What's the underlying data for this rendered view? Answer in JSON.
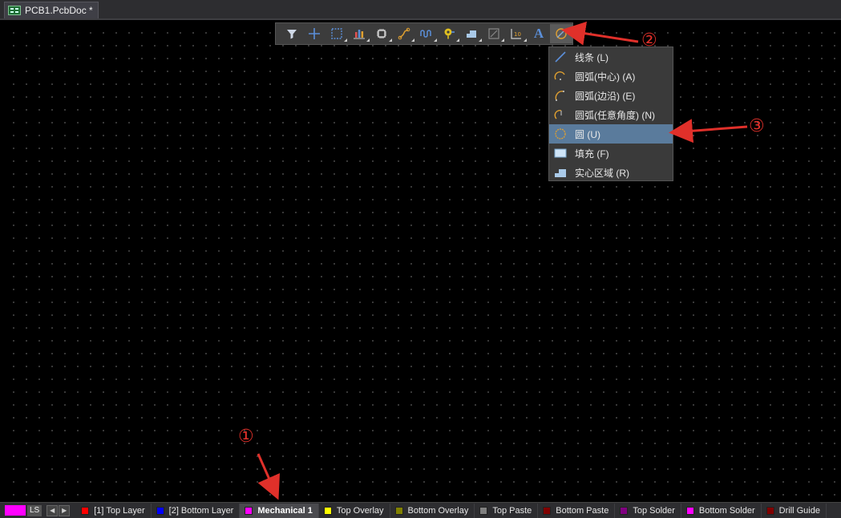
{
  "tab": {
    "title": "PCB1.PcbDoc *"
  },
  "toolbar": {
    "buttons": [
      {
        "name": "filter-icon"
      },
      {
        "name": "crosshair-icon"
      },
      {
        "name": "select-rect-icon"
      },
      {
        "name": "bar-chart-icon"
      },
      {
        "name": "component-icon"
      },
      {
        "name": "route-icon"
      },
      {
        "name": "tune-length-icon"
      },
      {
        "name": "pad-via-icon"
      },
      {
        "name": "polygon-icon"
      },
      {
        "name": "dimension-icon"
      },
      {
        "name": "designator-icon"
      },
      {
        "name": "text-icon",
        "label": "A"
      },
      {
        "name": "arc-shapes-icon"
      }
    ]
  },
  "menu": {
    "items": [
      {
        "label": "线条 (L)",
        "icon": "line-icon"
      },
      {
        "label": "圆弧(中心) (A)",
        "icon": "arc-center-icon"
      },
      {
        "label": "圆弧(边沿) (E)",
        "icon": "arc-edge-icon"
      },
      {
        "label": "圆弧(任意角度) (N)",
        "icon": "arc-any-angle-icon"
      },
      {
        "label": "圆 (U)",
        "icon": "circle-icon",
        "selected": true
      },
      {
        "label": "填充 (F)",
        "icon": "fill-icon"
      },
      {
        "label": "实心区域 (R)",
        "icon": "solid-region-icon"
      }
    ]
  },
  "annotations": {
    "a1": "①",
    "a2": "②",
    "a3": "③"
  },
  "layerbar": {
    "ls_label": "LS",
    "ls_color": "#ff00ff",
    "layers": [
      {
        "label": "[1] Top Layer",
        "color": "#ff0000"
      },
      {
        "label": "[2] Bottom Layer",
        "color": "#0000ff"
      },
      {
        "label": "Mechanical 1",
        "color": "#ff00ff",
        "active": true
      },
      {
        "label": "Top Overlay",
        "color": "#ffff00"
      },
      {
        "label": "Bottom Overlay",
        "color": "#808000"
      },
      {
        "label": "Top Paste",
        "color": "#808080"
      },
      {
        "label": "Bottom Paste",
        "color": "#800000"
      },
      {
        "label": "Top Solder",
        "color": "#800080"
      },
      {
        "label": "Bottom Solder",
        "color": "#ff00ff"
      },
      {
        "label": "Drill Guide",
        "color": "#800000"
      }
    ]
  }
}
